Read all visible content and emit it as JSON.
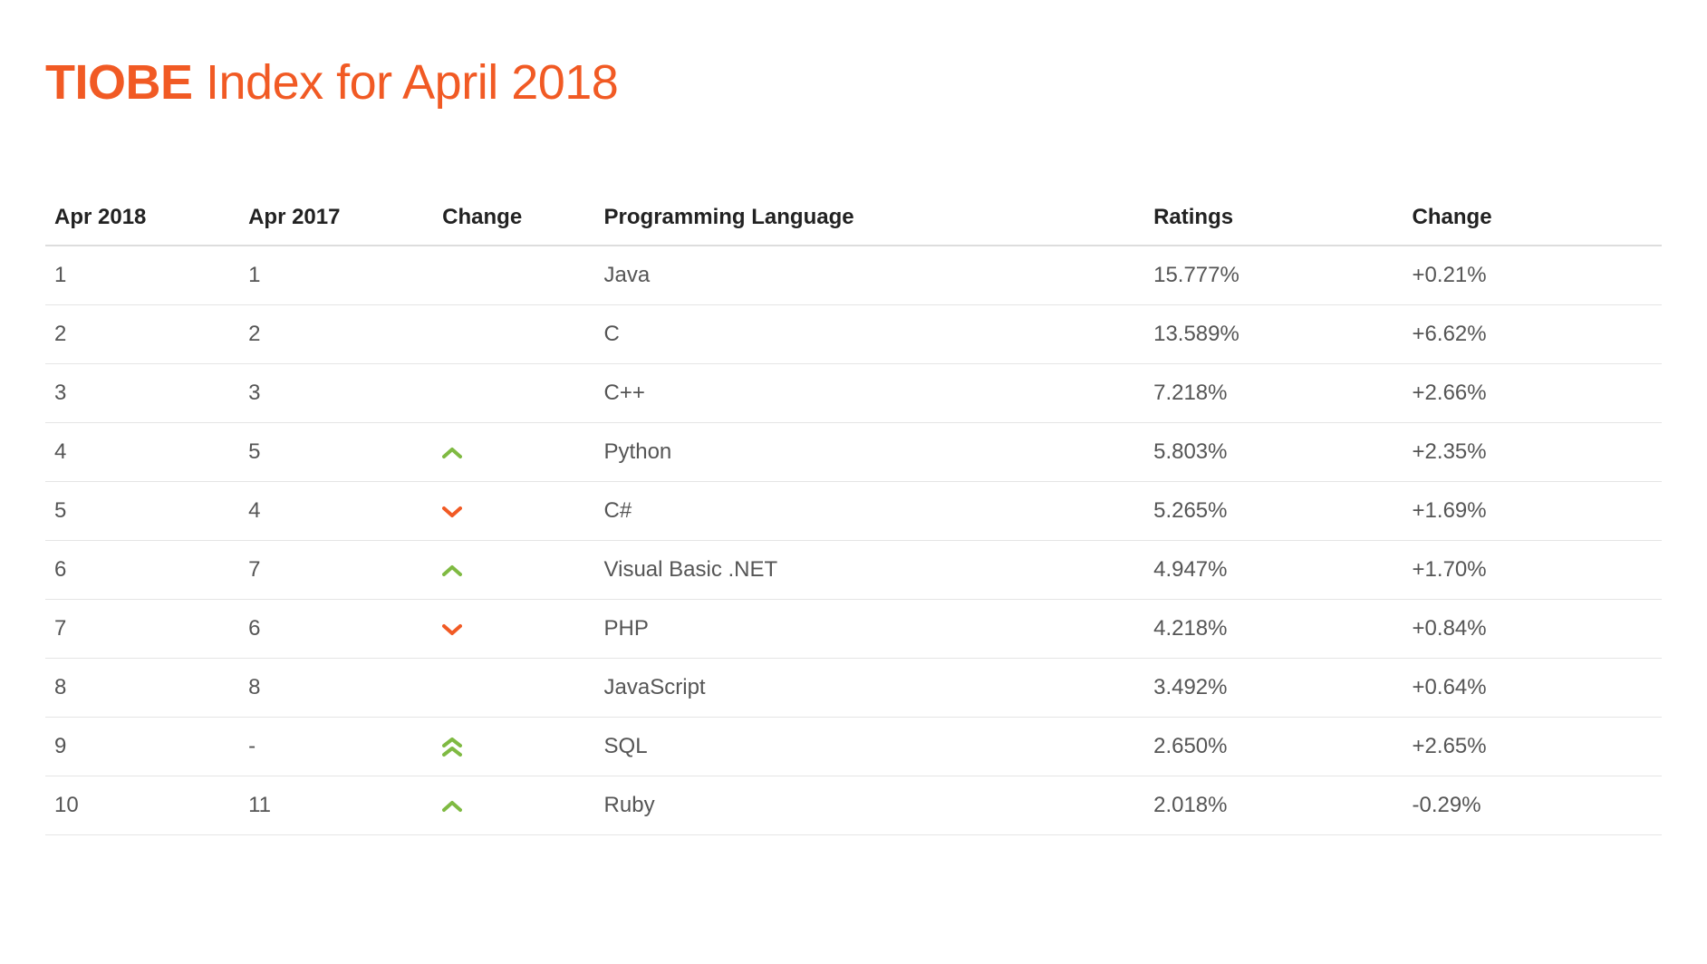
{
  "title": {
    "brand": "TIOBE",
    "rest": " Index for April 2018"
  },
  "colors": {
    "accent": "#F15A24",
    "up": "#7FBA42",
    "down": "#F15A24"
  },
  "table": {
    "headers": {
      "apr2018": "Apr 2018",
      "apr2017": "Apr 2017",
      "change": "Change",
      "language": "Programming Language",
      "ratings": "Ratings",
      "change_pct": "Change"
    },
    "rows": [
      {
        "apr2018": "1",
        "apr2017": "1",
        "change_icon": "",
        "language": "Java",
        "ratings": "15.777%",
        "change_pct": "+0.21%"
      },
      {
        "apr2018": "2",
        "apr2017": "2",
        "change_icon": "",
        "language": "C",
        "ratings": "13.589%",
        "change_pct": "+6.62%"
      },
      {
        "apr2018": "3",
        "apr2017": "3",
        "change_icon": "",
        "language": "C++",
        "ratings": "7.218%",
        "change_pct": "+2.66%"
      },
      {
        "apr2018": "4",
        "apr2017": "5",
        "change_icon": "up",
        "language": "Python",
        "ratings": "5.803%",
        "change_pct": "+2.35%"
      },
      {
        "apr2018": "5",
        "apr2017": "4",
        "change_icon": "down",
        "language": "C#",
        "ratings": "5.265%",
        "change_pct": "+1.69%"
      },
      {
        "apr2018": "6",
        "apr2017": "7",
        "change_icon": "up",
        "language": "Visual Basic .NET",
        "ratings": "4.947%",
        "change_pct": "+1.70%"
      },
      {
        "apr2018": "7",
        "apr2017": "6",
        "change_icon": "down",
        "language": "PHP",
        "ratings": "4.218%",
        "change_pct": "+0.84%"
      },
      {
        "apr2018": "8",
        "apr2017": "8",
        "change_icon": "",
        "language": "JavaScript",
        "ratings": "3.492%",
        "change_pct": "+0.64%"
      },
      {
        "apr2018": "9",
        "apr2017": "-",
        "change_icon": "double-up",
        "language": "SQL",
        "ratings": "2.650%",
        "change_pct": "+2.65%"
      },
      {
        "apr2018": "10",
        "apr2017": "11",
        "change_icon": "up",
        "language": "Ruby",
        "ratings": "2.018%",
        "change_pct": "-0.29%"
      }
    ]
  }
}
